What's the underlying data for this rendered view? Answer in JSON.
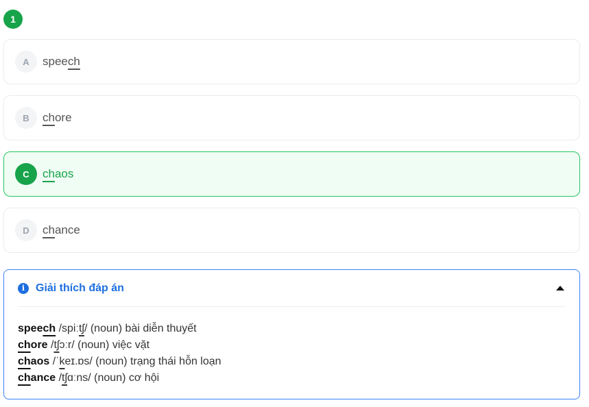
{
  "question": {
    "number": "1"
  },
  "options": [
    {
      "letter": "A",
      "pre": "spee",
      "ul": "ch",
      "post": ""
    },
    {
      "letter": "B",
      "pre": "",
      "ul": "ch",
      "post": "ore"
    },
    {
      "letter": "C",
      "pre": "",
      "ul": "ch",
      "post": "aos",
      "selected": true
    },
    {
      "letter": "D",
      "pre": "",
      "ul": "ch",
      "post": "ance"
    }
  ],
  "explanation": {
    "title": "Giải thích đáp án",
    "lines": [
      {
        "w_pre": "spee",
        "w_ul": "ch",
        "w_post": "",
        "ipa_pre": " /spiː",
        "ipa_ul": "tʃ",
        "ipa_post": "/",
        "pos": " (noun)",
        "meaning": " bài diễn thuyết"
      },
      {
        "w_pre": "",
        "w_ul": "ch",
        "w_post": "ore",
        "ipa_pre": " /",
        "ipa_ul": "tʃ",
        "ipa_post": "ɔːr/",
        "pos": " (noun)",
        "meaning": " việc vặt"
      },
      {
        "w_pre": "",
        "w_ul": "ch",
        "w_post": "aos",
        "ipa_pre": " /ˈ",
        "ipa_ul": "k",
        "ipa_post": "eɪ.ɒs/",
        "pos": " (noun)",
        "meaning": " trạng thái hỗn loạn"
      },
      {
        "w_pre": "",
        "w_ul": "ch",
        "w_post": "ance",
        "ipa_pre": " /",
        "ipa_ul": "tʃ",
        "ipa_post": "ɑːns/",
        "pos": " (noun)",
        "meaning": " cơ hội"
      }
    ]
  },
  "colors": {
    "correct": "#16a34a",
    "info": "#1d6fe0"
  }
}
